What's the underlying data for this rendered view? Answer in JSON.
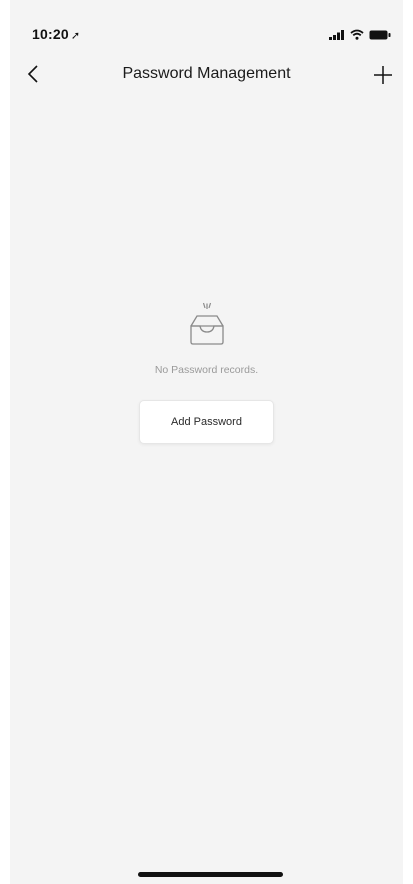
{
  "status_bar": {
    "time": "10:20",
    "location_glyph": "➚",
    "icons": [
      "signal-icon",
      "wifi-icon",
      "battery-icon"
    ]
  },
  "nav": {
    "title": "Password Management",
    "back_icon": "chevron-left-icon",
    "add_icon": "plus-icon"
  },
  "empty_state": {
    "icon": "empty-inbox-icon",
    "message": "No Password records.",
    "button_label": "Add Password"
  },
  "colors": {
    "background": "#f4f4f4",
    "text": "#1a1a1a",
    "muted_text": "#9a9a9a",
    "button_bg": "#ffffff"
  }
}
